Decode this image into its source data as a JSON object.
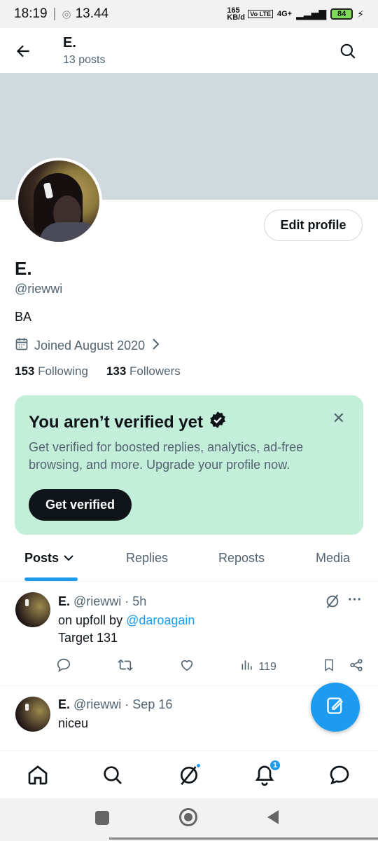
{
  "status": {
    "time": "18:19",
    "extra": "13.44",
    "speed": "165 KB/d",
    "network": "4G+",
    "battery": "84"
  },
  "header": {
    "title": "E.",
    "posts_count": "13 posts"
  },
  "profile": {
    "name": "E.",
    "handle": "@riewwi",
    "bio": "BA",
    "joined": "Joined August 2020",
    "following_count": "153",
    "following_label": "Following",
    "followers_count": "133",
    "followers_label": "Followers",
    "edit_label": "Edit profile"
  },
  "verify_card": {
    "title": "You aren’t verified yet",
    "desc": "Get verified for boosted replies, analytics, ad-free browsing, and more. Upgrade your profile now.",
    "button": "Get verified"
  },
  "tabs": [
    {
      "label": "Posts"
    },
    {
      "label": "Replies"
    },
    {
      "label": "Reposts"
    },
    {
      "label": "Media"
    }
  ],
  "posts": [
    {
      "name": "E.",
      "meta": "@riewwi · 5h",
      "text_prefix": "on upfoll by ",
      "mention": "@daroagain",
      "text2": "Target 131",
      "views": "119"
    },
    {
      "name": "E.",
      "meta": "@riewwi · Sep 16",
      "text": "niceu"
    }
  ],
  "notifications_badge": "1",
  "accent": "#1d9bf0"
}
